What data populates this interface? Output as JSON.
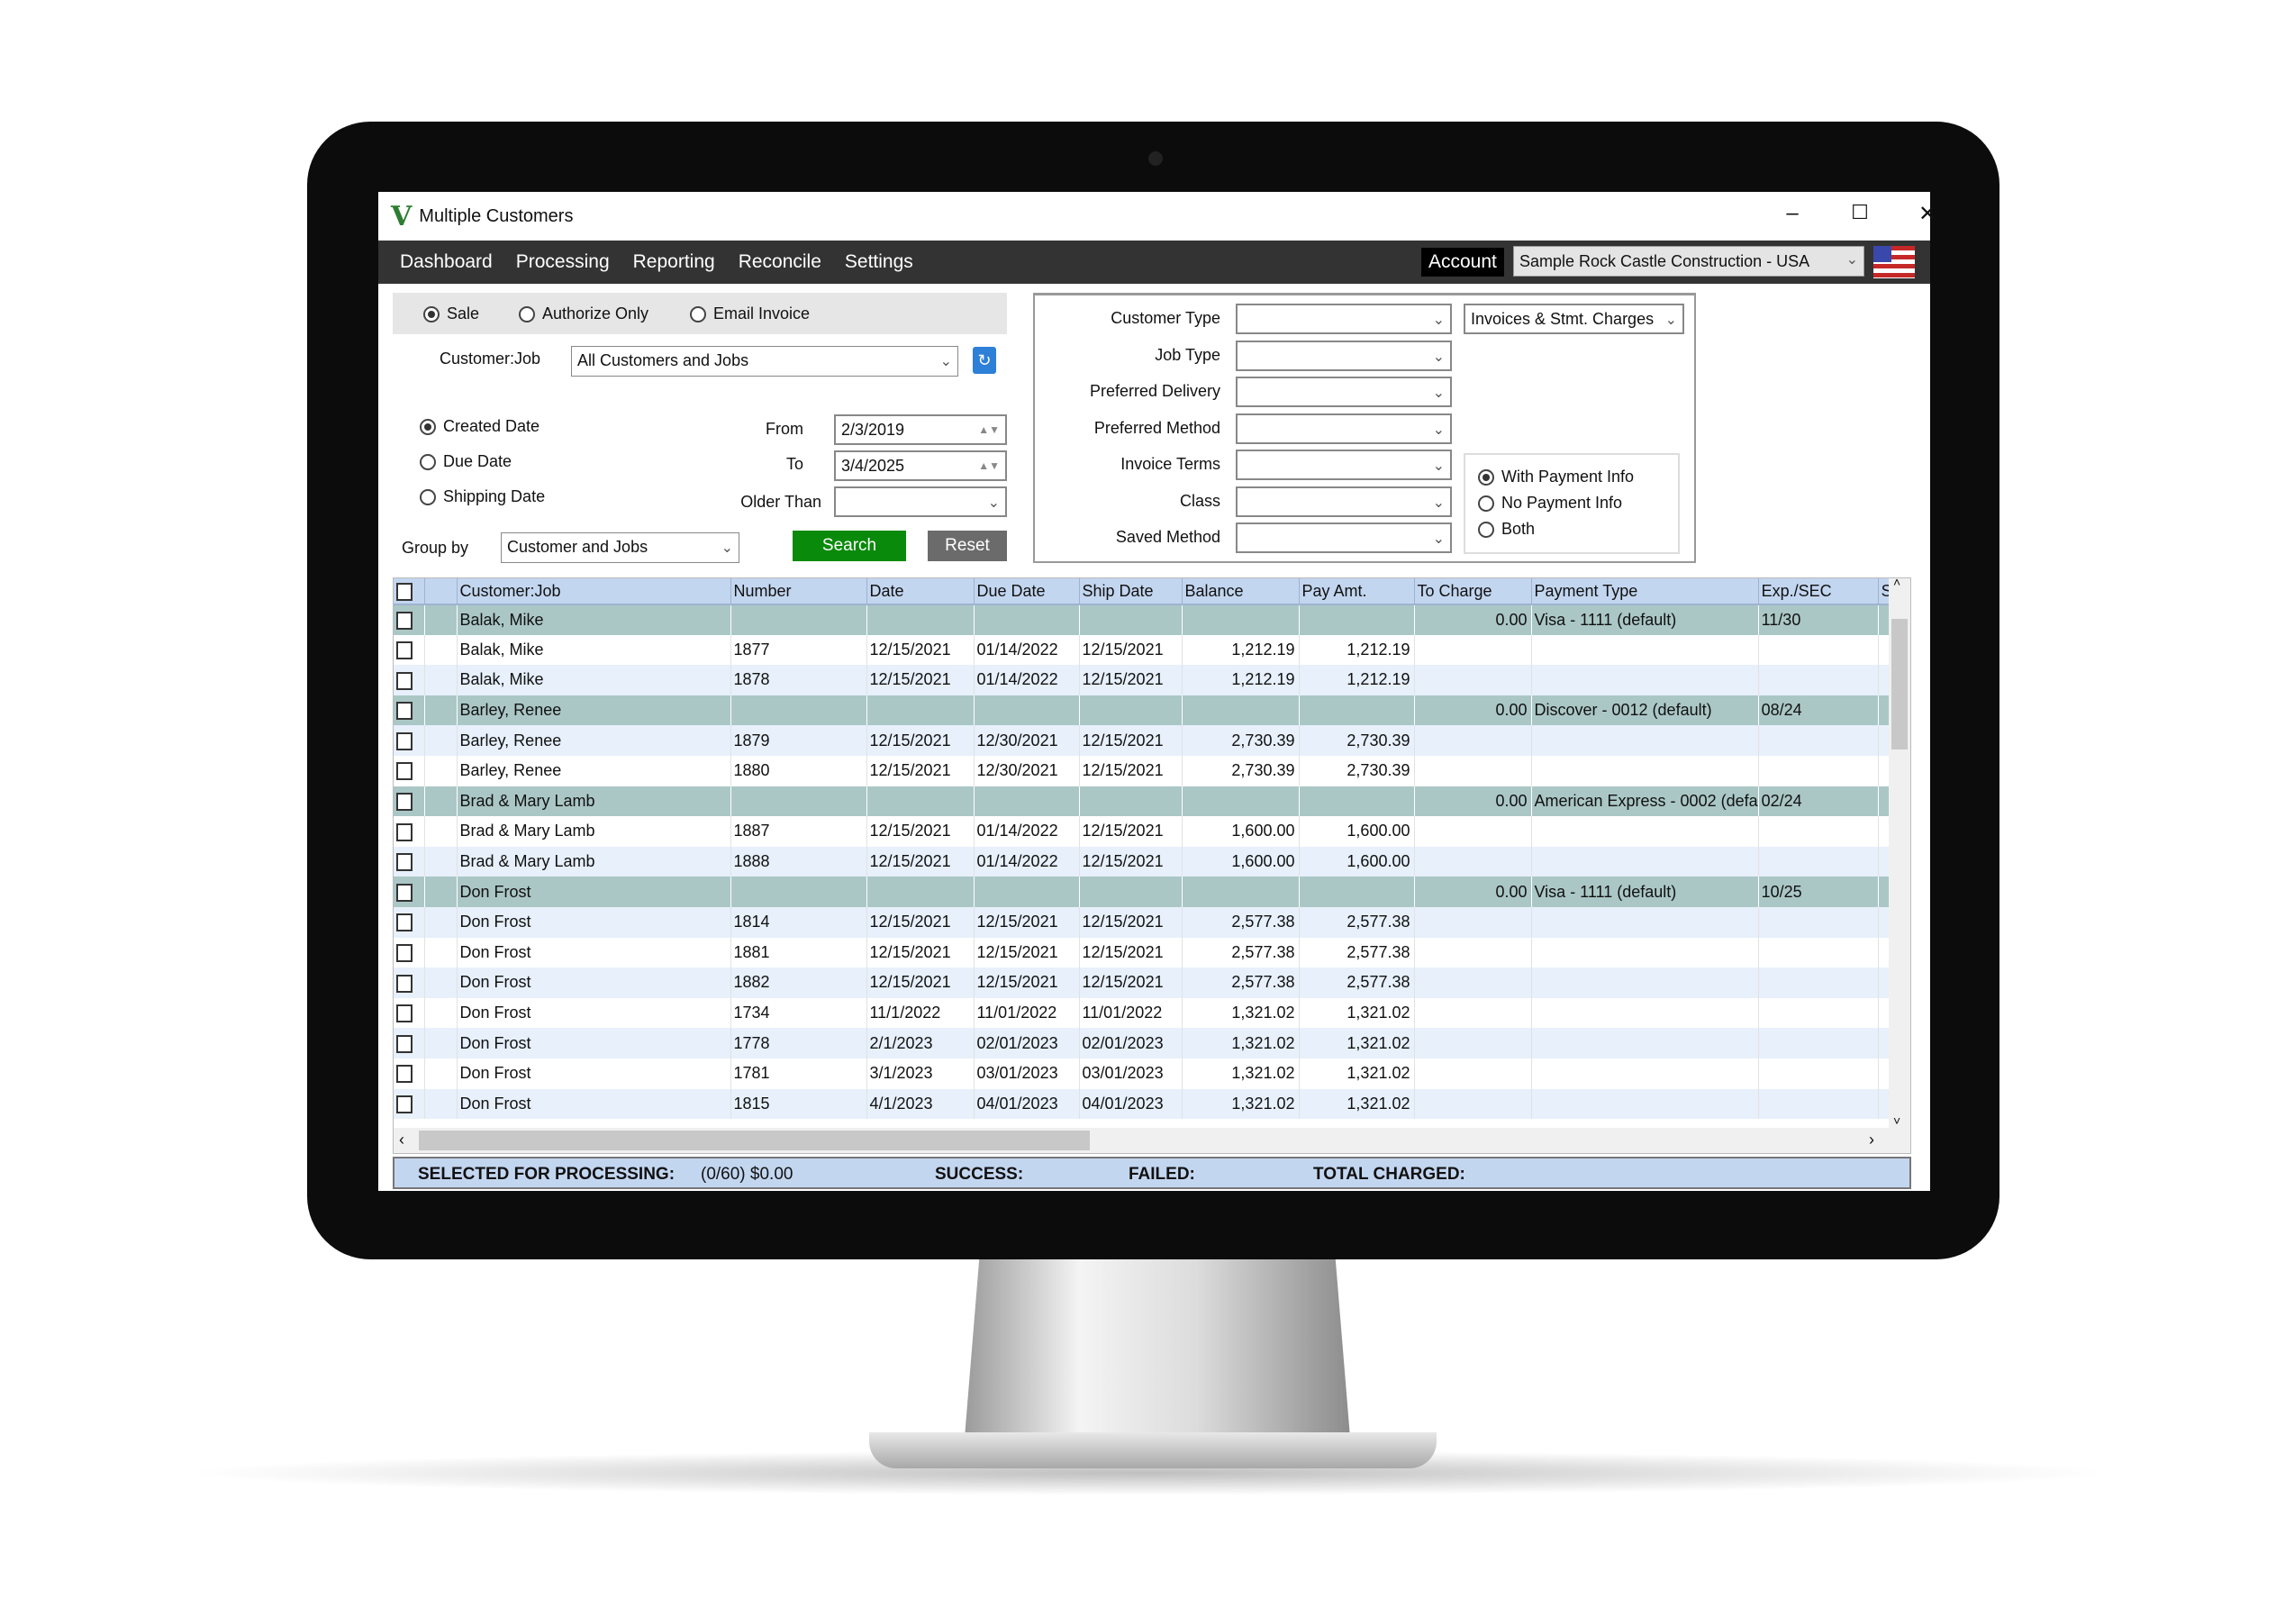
{
  "window": {
    "title": "Multiple Customers",
    "logo": "V"
  },
  "menu": {
    "items": [
      "Dashboard",
      "Processing",
      "Reporting",
      "Reconcile",
      "Settings"
    ],
    "account_label": "Account",
    "account_value": "Sample Rock Castle Construction - USA",
    "flag_icon": "us-flag-icon"
  },
  "mode": {
    "options": [
      "Sale",
      "Authorize Only",
      "Email Invoice"
    ],
    "selected": "Sale"
  },
  "customer_job": {
    "label": "Customer:Job",
    "value": "All Customers and Jobs"
  },
  "date_type": {
    "options": [
      "Created Date",
      "Due Date",
      "Shipping Date"
    ],
    "selected": "Created Date"
  },
  "date_range": {
    "from_label": "From",
    "from": "2/3/2019",
    "to_label": "To",
    "to": "3/4/2025",
    "older_than_label": "Older Than",
    "older_than": ""
  },
  "group_by": {
    "label": "Group by",
    "value": "Customer and Jobs"
  },
  "buttons": {
    "search": "Search",
    "reset": "Reset"
  },
  "colors": {
    "search": "#0a8a0a",
    "reset": "#6b6b6b",
    "header": "#c3d6f0",
    "group_row": "#aac7c6",
    "alt_row": "#e7f0fb",
    "menubar": "#333333"
  },
  "filters": {
    "fields": [
      {
        "label": "Customer Type",
        "value": ""
      },
      {
        "label": "Job Type",
        "value": ""
      },
      {
        "label": "Preferred Delivery",
        "value": ""
      },
      {
        "label": "Preferred Method",
        "value": ""
      },
      {
        "label": "Invoice Terms",
        "value": ""
      },
      {
        "label": "Class",
        "value": ""
      },
      {
        "label": "Saved Method",
        "value": ""
      }
    ],
    "doc_type": "Invoices & Stmt. Charges",
    "payment_info": {
      "options": [
        "With Payment Info",
        "No Payment Info",
        "Both"
      ],
      "selected": "With Payment Info"
    }
  },
  "grid": {
    "columns": [
      "Customer:Job",
      "Number",
      "Date",
      "Due Date",
      "Ship Date",
      "Balance",
      "Pay Amt.",
      "To Charge",
      "Payment Type",
      "Exp./SEC",
      "S"
    ],
    "rows": [
      {
        "type": "group",
        "customer": "Balak, Mike",
        "number": "",
        "date": "",
        "due": "",
        "ship": "",
        "balance": "",
        "pay": "",
        "charge": "0.00",
        "payment_type": "Visa - 1111 (default)",
        "exp": "11/30"
      },
      {
        "type": "item",
        "customer": "Balak, Mike",
        "number": "1877",
        "date": "12/15/2021",
        "due": "01/14/2022",
        "ship": "12/15/2021",
        "balance": "1,212.19",
        "pay": "1,212.19",
        "charge": "",
        "payment_type": "",
        "exp": ""
      },
      {
        "type": "item",
        "customer": "Balak, Mike",
        "number": "1878",
        "date": "12/15/2021",
        "due": "01/14/2022",
        "ship": "12/15/2021",
        "balance": "1,212.19",
        "pay": "1,212.19",
        "charge": "",
        "payment_type": "",
        "exp": ""
      },
      {
        "type": "group",
        "customer": "Barley, Renee",
        "number": "",
        "date": "",
        "due": "",
        "ship": "",
        "balance": "",
        "pay": "",
        "charge": "0.00",
        "payment_type": "Discover - 0012 (default)",
        "exp": "08/24"
      },
      {
        "type": "item",
        "customer": "Barley, Renee",
        "number": "1879",
        "date": "12/15/2021",
        "due": "12/30/2021",
        "ship": "12/15/2021",
        "balance": "2,730.39",
        "pay": "2,730.39",
        "charge": "",
        "payment_type": "",
        "exp": ""
      },
      {
        "type": "item",
        "customer": "Barley, Renee",
        "number": "1880",
        "date": "12/15/2021",
        "due": "12/30/2021",
        "ship": "12/15/2021",
        "balance": "2,730.39",
        "pay": "2,730.39",
        "charge": "",
        "payment_type": "",
        "exp": ""
      },
      {
        "type": "group",
        "customer": "Brad & Mary Lamb",
        "number": "",
        "date": "",
        "due": "",
        "ship": "",
        "balance": "",
        "pay": "",
        "charge": "0.00",
        "payment_type": "American Express - 0002 (defa",
        "exp": "02/24"
      },
      {
        "type": "item",
        "customer": "Brad & Mary Lamb",
        "number": "1887",
        "date": "12/15/2021",
        "due": "01/14/2022",
        "ship": "12/15/2021",
        "balance": "1,600.00",
        "pay": "1,600.00",
        "charge": "",
        "payment_type": "",
        "exp": ""
      },
      {
        "type": "item",
        "customer": "Brad & Mary Lamb",
        "number": "1888",
        "date": "12/15/2021",
        "due": "01/14/2022",
        "ship": "12/15/2021",
        "balance": "1,600.00",
        "pay": "1,600.00",
        "charge": "",
        "payment_type": "",
        "exp": ""
      },
      {
        "type": "group",
        "customer": "Don Frost",
        "number": "",
        "date": "",
        "due": "",
        "ship": "",
        "balance": "",
        "pay": "",
        "charge": "0.00",
        "payment_type": "Visa - 1111 (default)",
        "exp": "10/25"
      },
      {
        "type": "item",
        "customer": "Don Frost",
        "number": "1814",
        "date": "12/15/2021",
        "due": "12/15/2021",
        "ship": "12/15/2021",
        "balance": "2,577.38",
        "pay": "2,577.38",
        "charge": "",
        "payment_type": "",
        "exp": ""
      },
      {
        "type": "item",
        "customer": "Don Frost",
        "number": "1881",
        "date": "12/15/2021",
        "due": "12/15/2021",
        "ship": "12/15/2021",
        "balance": "2,577.38",
        "pay": "2,577.38",
        "charge": "",
        "payment_type": "",
        "exp": ""
      },
      {
        "type": "item",
        "customer": "Don Frost",
        "number": "1882",
        "date": "12/15/2021",
        "due": "12/15/2021",
        "ship": "12/15/2021",
        "balance": "2,577.38",
        "pay": "2,577.38",
        "charge": "",
        "payment_type": "",
        "exp": ""
      },
      {
        "type": "item",
        "customer": "Don Frost",
        "number": "1734",
        "date": "11/1/2022",
        "due": "11/01/2022",
        "ship": "11/01/2022",
        "balance": "1,321.02",
        "pay": "1,321.02",
        "charge": "",
        "payment_type": "",
        "exp": ""
      },
      {
        "type": "item",
        "customer": "Don Frost",
        "number": "1778",
        "date": "2/1/2023",
        "due": "02/01/2023",
        "ship": "02/01/2023",
        "balance": "1,321.02",
        "pay": "1,321.02",
        "charge": "",
        "payment_type": "",
        "exp": ""
      },
      {
        "type": "item",
        "customer": "Don Frost",
        "number": "1781",
        "date": "3/1/2023",
        "due": "03/01/2023",
        "ship": "03/01/2023",
        "balance": "1,321.02",
        "pay": "1,321.02",
        "charge": "",
        "payment_type": "",
        "exp": ""
      },
      {
        "type": "item",
        "customer": "Don Frost",
        "number": "1815",
        "date": "4/1/2023",
        "due": "04/01/2023",
        "ship": "04/01/2023",
        "balance": "1,321.02",
        "pay": "1,321.02",
        "charge": "",
        "payment_type": "",
        "exp": ""
      }
    ]
  },
  "status": {
    "selected_label": "SELECTED FOR PROCESSING:",
    "selected_value": "(0/60) $0.00",
    "success_label": "SUCCESS:",
    "failed_label": "FAILED:",
    "total_label": "TOTAL CHARGED:"
  }
}
